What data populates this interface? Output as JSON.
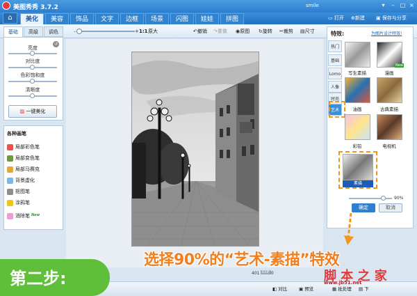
{
  "app": {
    "title": "美图秀秀 3.7.2",
    "user": "smile"
  },
  "nav": {
    "tabs": [
      "美化",
      "美容",
      "饰品",
      "文字",
      "边框",
      "场景",
      "闪图",
      "娃娃",
      "拼图"
    ],
    "open": "打开",
    "new": "新建",
    "save": "保存与分享"
  },
  "toolbar": {
    "scale": "1:1",
    "original_size": "原大",
    "undo": "撤销",
    "redo": "重做",
    "original": "原图",
    "rotate": "旋转",
    "crop": "裁剪",
    "resize": "尺寸"
  },
  "left": {
    "tabs": [
      "基础",
      "高级",
      "调色"
    ],
    "sliders": [
      {
        "label": "亮度",
        "value": 0.5
      },
      {
        "label": "对比度",
        "value": 0.5
      },
      {
        "label": "色彩饱和度",
        "value": 0.5
      },
      {
        "label": "清晰度",
        "value": 0.5
      }
    ],
    "oneclick": "一键美化",
    "brush_title": "各种画笔",
    "brushes": [
      "局部彩色笔",
      "局部变色笔",
      "局部马赛克",
      "背景虚化",
      "抠图笔",
      "涂鸦笔",
      "消除笔"
    ],
    "new_badge": "New"
  },
  "right": {
    "title": "特效:",
    "link": "为图片设计特效!",
    "tabs": [
      "热门",
      "基础",
      "Lomo",
      "人像",
      "时尚",
      "艺术"
    ],
    "effects": [
      "写生素描",
      "漫画",
      "油画",
      "古典素描",
      "彩铅",
      "电视机"
    ],
    "selected": "素描",
    "intensity": "90%",
    "ok": "确定",
    "cancel": "取消",
    "new_badge": "New"
  },
  "canvas": {
    "size": "401 × 600",
    "exif": "EXIF"
  },
  "bottom": {
    "compare": "对比",
    "preview": "预览",
    "batch": "批处理",
    "download": "下"
  },
  "overlay": {
    "step": "第二步:",
    "caption": "选择90%的“艺术-素描”特效",
    "watermark": "脚 本 之 家",
    "watermark_url": "www.jb51.net"
  }
}
